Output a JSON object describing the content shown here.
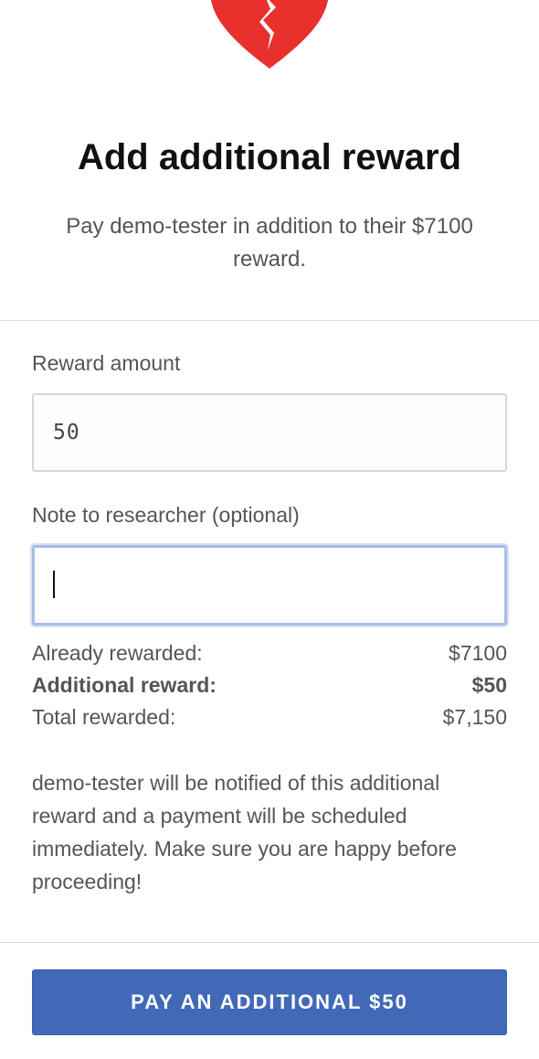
{
  "header": {
    "icon": "broken-heart-icon",
    "icon_color": "#e8302c",
    "title": "Add additional reward",
    "subtitle": "Pay demo-tester in addition to their $7100 reward."
  },
  "form": {
    "reward_amount_label": "Reward amount",
    "reward_amount_value": "50",
    "note_label": "Note to researcher (optional)",
    "note_value": ""
  },
  "summary": {
    "already_rewarded_label": "Already rewarded:",
    "already_rewarded_value": "$7100",
    "additional_reward_label": "Additional reward:",
    "additional_reward_value": "$50",
    "total_rewarded_label": "Total rewarded:",
    "total_rewarded_value": "$7,150"
  },
  "notice": "demo-tester will be notified of this additional reward and a payment will be scheduled immediately. Make sure you are happy before proceeding!",
  "actions": {
    "pay_button_label": "PAY AN ADDITIONAL $50",
    "button_color": "#4169b8"
  }
}
